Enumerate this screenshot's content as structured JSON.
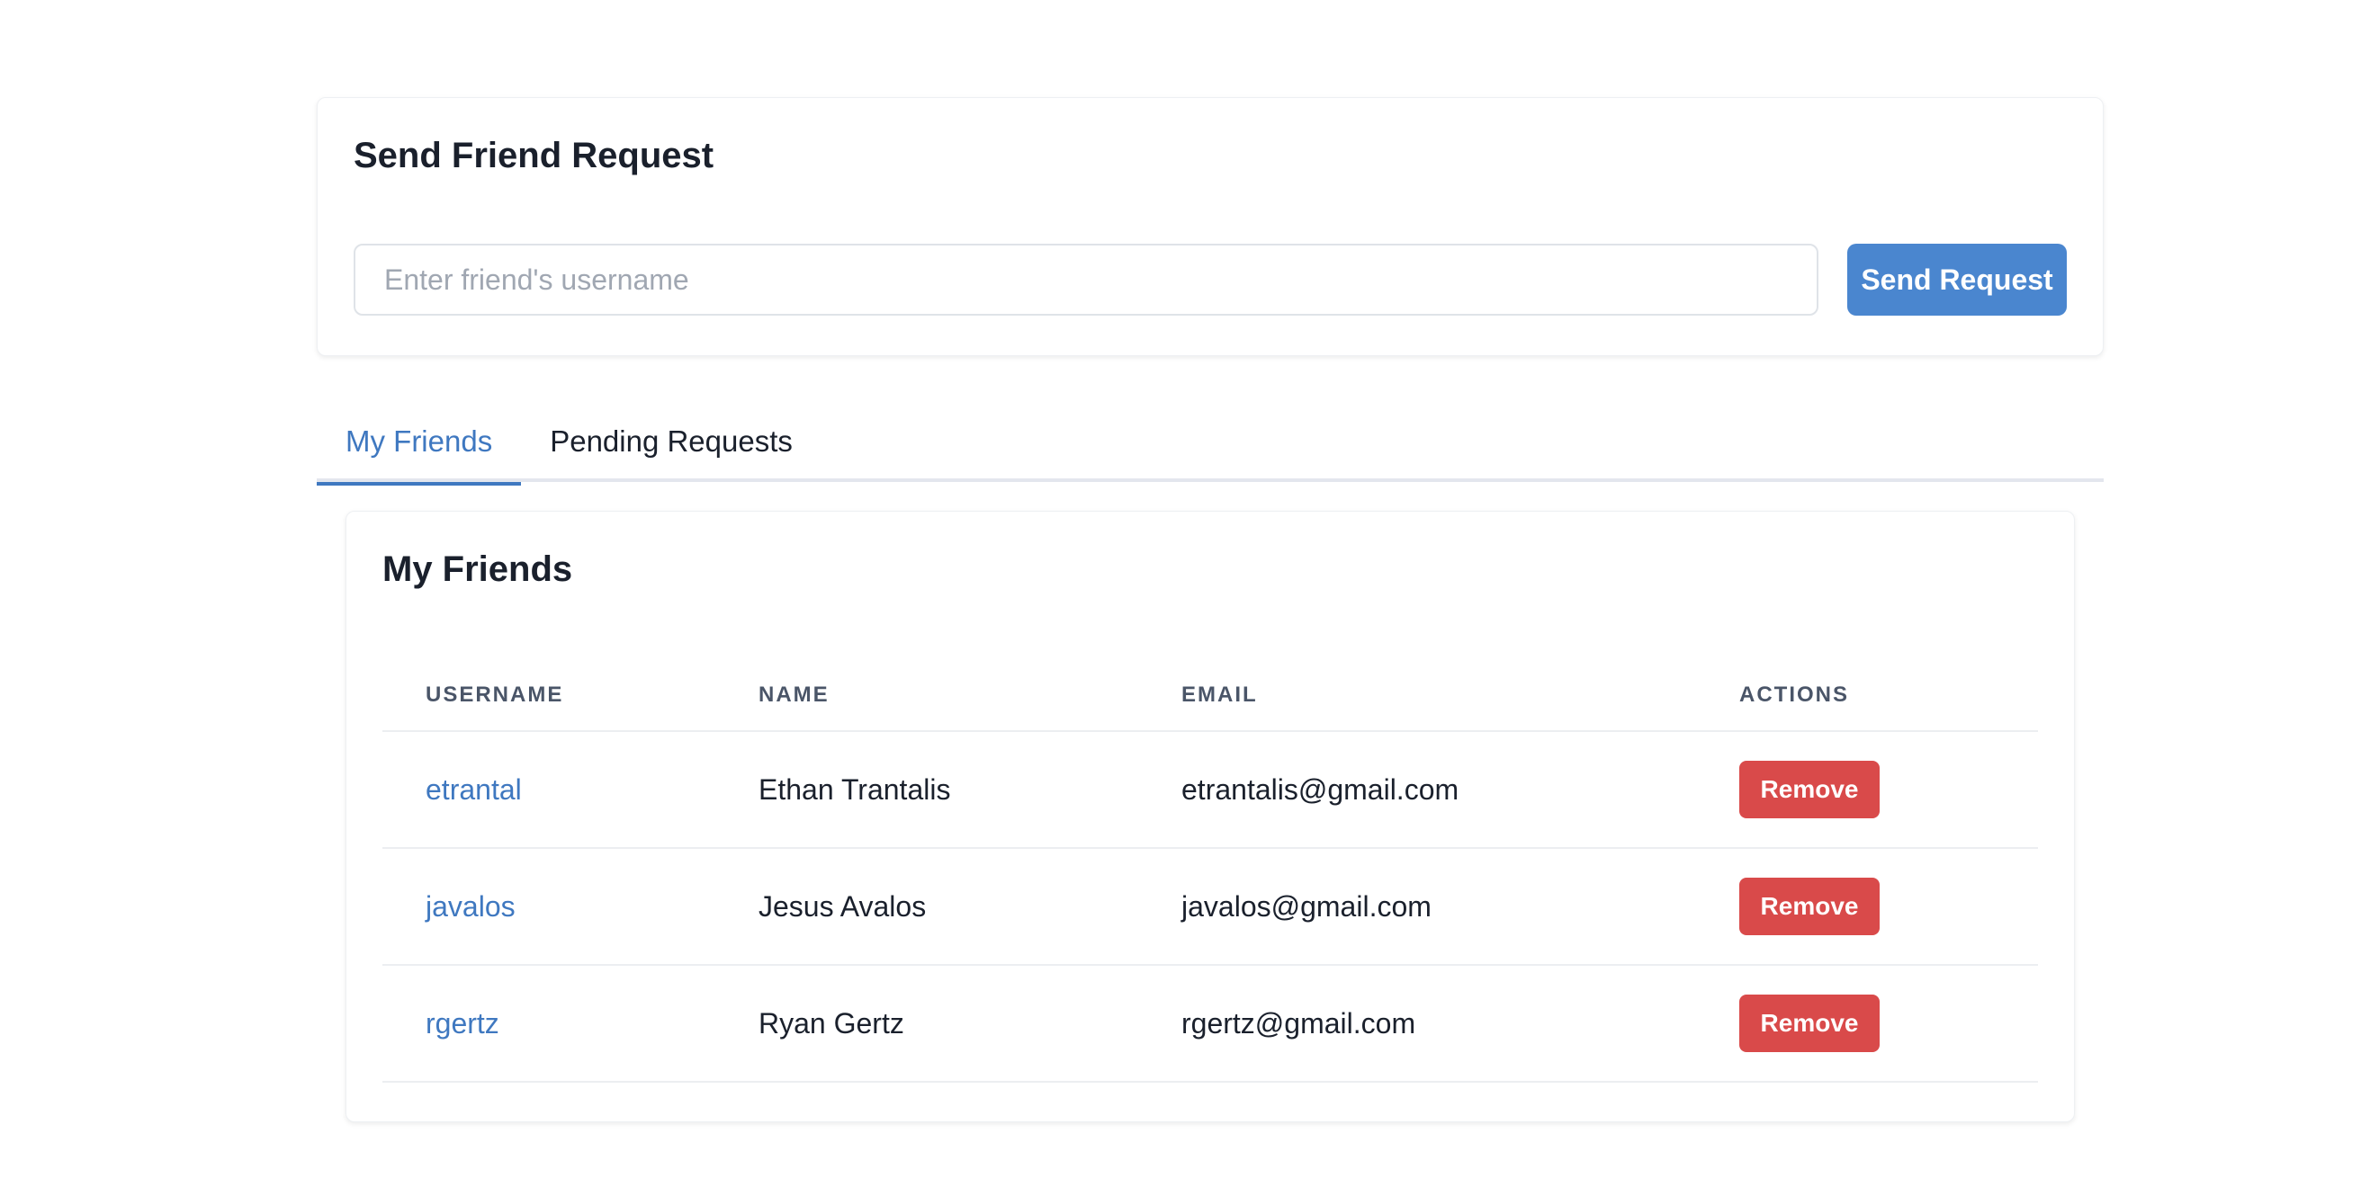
{
  "send_request": {
    "title": "Send Friend Request",
    "input_value": "",
    "input_placeholder": "Enter friend's username",
    "button_label": "Send Request"
  },
  "tabs": [
    {
      "label": "My Friends",
      "active": true
    },
    {
      "label": "Pending Requests",
      "active": false
    }
  ],
  "friends": {
    "title": "My Friends",
    "columns": {
      "username": "USERNAME",
      "name": "NAME",
      "email": "EMAIL",
      "actions": "ACTIONS"
    },
    "rows": [
      {
        "username": "etrantal",
        "name": "Ethan Trantalis",
        "email": "etrantalis@gmail.com",
        "action": "Remove"
      },
      {
        "username": "javalos",
        "name": "Jesus Avalos",
        "email": "javalos@gmail.com",
        "action": "Remove"
      },
      {
        "username": "rgertz",
        "name": "Ryan Gertz",
        "email": "rgertz@gmail.com",
        "action": "Remove"
      }
    ]
  },
  "colors": {
    "accent": "#4a86cf",
    "link": "#3f78c0",
    "danger": "#d94a4a",
    "text": "#1a202c",
    "muted": "#4a5568"
  }
}
